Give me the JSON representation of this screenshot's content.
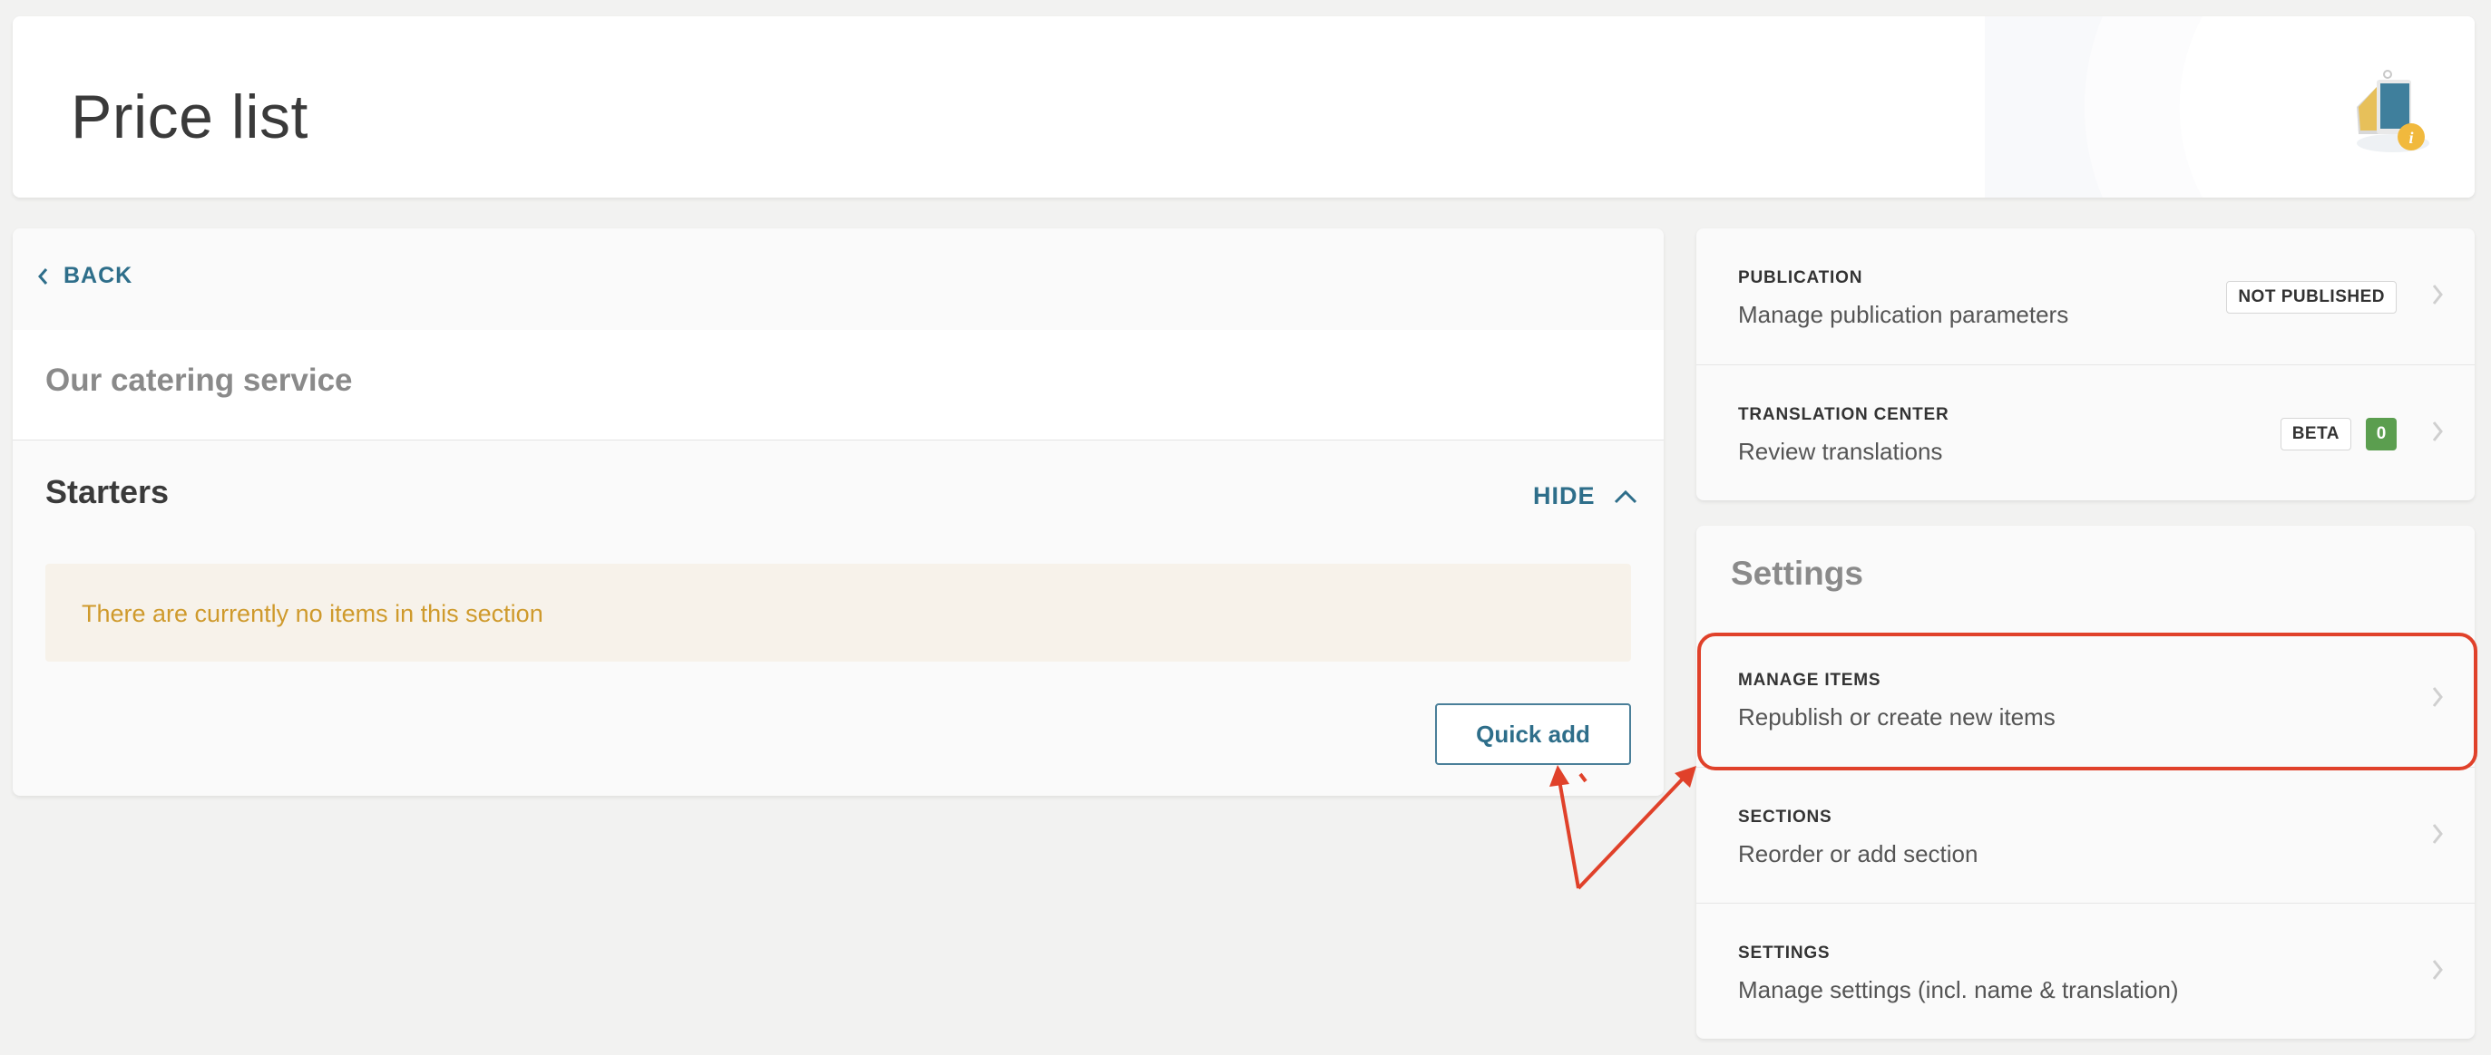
{
  "page": {
    "title": "Price list"
  },
  "left": {
    "back_label": "BACK",
    "list_name": "Our catering service",
    "section_name": "Starters",
    "hide_label": "HIDE",
    "empty_message": "There are currently no items in this section",
    "quick_add_label": "Quick add"
  },
  "right": {
    "publication": {
      "label": "PUBLICATION",
      "desc": "Manage publication parameters",
      "status": "NOT PUBLISHED"
    },
    "translation": {
      "label": "TRANSLATION CENTER",
      "desc": "Review translations",
      "beta": "BETA",
      "count": "0"
    },
    "settings_heading": "Settings",
    "manage_items": {
      "label": "MANAGE ITEMS",
      "desc": "Republish or create new items"
    },
    "sections": {
      "label": "SECTIONS",
      "desc": "Reorder or add section"
    },
    "settings": {
      "label": "SETTINGS",
      "desc": "Manage settings (incl. name & translation)"
    }
  },
  "colors": {
    "accent": "#2e6e8a",
    "warning_text": "#cf9a2c",
    "annotation": "#e0412a",
    "count_badge": "#5b9e4f"
  },
  "icons": {
    "back": "chevron-left-icon",
    "hide": "chevron-up-icon",
    "row_nav": "chevron-right-icon",
    "illustration": "price-tag-info-icon"
  }
}
